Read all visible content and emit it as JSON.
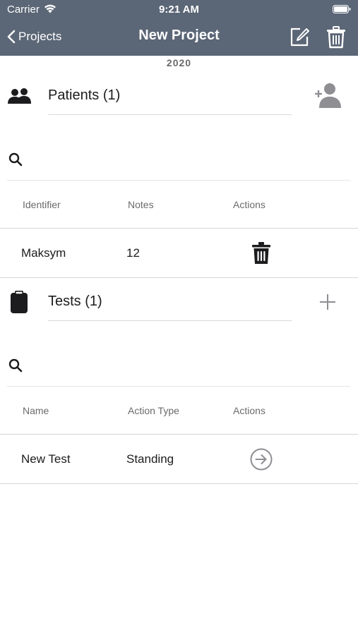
{
  "status_bar": {
    "carrier": "Carrier",
    "time": "9:21 AM"
  },
  "nav": {
    "back_label": "Projects",
    "title": "New Project"
  },
  "year": "2020",
  "patients": {
    "title": "Patients (1)",
    "columns": [
      "Identifier",
      "Notes",
      "Actions"
    ],
    "rows": [
      {
        "identifier": "Maksym",
        "notes": "12"
      }
    ]
  },
  "tests": {
    "title": "Tests (1)",
    "columns": [
      "Name",
      "Action Type",
      "Actions"
    ],
    "rows": [
      {
        "name": "New Test",
        "action_type": "Standing"
      }
    ]
  },
  "colors": {
    "header_bg": "#5b6676",
    "icon_gray": "#8e8e93",
    "divider": "#d6d6d6"
  }
}
